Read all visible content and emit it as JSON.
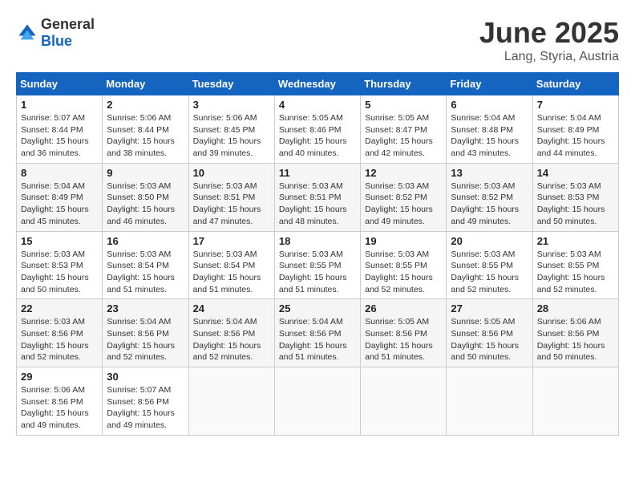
{
  "header": {
    "logo_general": "General",
    "logo_blue": "Blue",
    "title": "June 2025",
    "subtitle": "Lang, Styria, Austria"
  },
  "days_of_week": [
    "Sunday",
    "Monday",
    "Tuesday",
    "Wednesday",
    "Thursday",
    "Friday",
    "Saturday"
  ],
  "weeks": [
    [
      {
        "day": "1",
        "sunrise": "5:07 AM",
        "sunset": "8:44 PM",
        "daylight": "15 hours and 36 minutes."
      },
      {
        "day": "2",
        "sunrise": "5:06 AM",
        "sunset": "8:44 PM",
        "daylight": "15 hours and 38 minutes."
      },
      {
        "day": "3",
        "sunrise": "5:06 AM",
        "sunset": "8:45 PM",
        "daylight": "15 hours and 39 minutes."
      },
      {
        "day": "4",
        "sunrise": "5:05 AM",
        "sunset": "8:46 PM",
        "daylight": "15 hours and 40 minutes."
      },
      {
        "day": "5",
        "sunrise": "5:05 AM",
        "sunset": "8:47 PM",
        "daylight": "15 hours and 42 minutes."
      },
      {
        "day": "6",
        "sunrise": "5:04 AM",
        "sunset": "8:48 PM",
        "daylight": "15 hours and 43 minutes."
      },
      {
        "day": "7",
        "sunrise": "5:04 AM",
        "sunset": "8:49 PM",
        "daylight": "15 hours and 44 minutes."
      }
    ],
    [
      {
        "day": "8",
        "sunrise": "5:04 AM",
        "sunset": "8:49 PM",
        "daylight": "15 hours and 45 minutes."
      },
      {
        "day": "9",
        "sunrise": "5:03 AM",
        "sunset": "8:50 PM",
        "daylight": "15 hours and 46 minutes."
      },
      {
        "day": "10",
        "sunrise": "5:03 AM",
        "sunset": "8:51 PM",
        "daylight": "15 hours and 47 minutes."
      },
      {
        "day": "11",
        "sunrise": "5:03 AM",
        "sunset": "8:51 PM",
        "daylight": "15 hours and 48 minutes."
      },
      {
        "day": "12",
        "sunrise": "5:03 AM",
        "sunset": "8:52 PM",
        "daylight": "15 hours and 49 minutes."
      },
      {
        "day": "13",
        "sunrise": "5:03 AM",
        "sunset": "8:52 PM",
        "daylight": "15 hours and 49 minutes."
      },
      {
        "day": "14",
        "sunrise": "5:03 AM",
        "sunset": "8:53 PM",
        "daylight": "15 hours and 50 minutes."
      }
    ],
    [
      {
        "day": "15",
        "sunrise": "5:03 AM",
        "sunset": "8:53 PM",
        "daylight": "15 hours and 50 minutes."
      },
      {
        "day": "16",
        "sunrise": "5:03 AM",
        "sunset": "8:54 PM",
        "daylight": "15 hours and 51 minutes."
      },
      {
        "day": "17",
        "sunrise": "5:03 AM",
        "sunset": "8:54 PM",
        "daylight": "15 hours and 51 minutes."
      },
      {
        "day": "18",
        "sunrise": "5:03 AM",
        "sunset": "8:55 PM",
        "daylight": "15 hours and 51 minutes."
      },
      {
        "day": "19",
        "sunrise": "5:03 AM",
        "sunset": "8:55 PM",
        "daylight": "15 hours and 52 minutes."
      },
      {
        "day": "20",
        "sunrise": "5:03 AM",
        "sunset": "8:55 PM",
        "daylight": "15 hours and 52 minutes."
      },
      {
        "day": "21",
        "sunrise": "5:03 AM",
        "sunset": "8:55 PM",
        "daylight": "15 hours and 52 minutes."
      }
    ],
    [
      {
        "day": "22",
        "sunrise": "5:03 AM",
        "sunset": "8:56 PM",
        "daylight": "15 hours and 52 minutes."
      },
      {
        "day": "23",
        "sunrise": "5:04 AM",
        "sunset": "8:56 PM",
        "daylight": "15 hours and 52 minutes."
      },
      {
        "day": "24",
        "sunrise": "5:04 AM",
        "sunset": "8:56 PM",
        "daylight": "15 hours and 52 minutes."
      },
      {
        "day": "25",
        "sunrise": "5:04 AM",
        "sunset": "8:56 PM",
        "daylight": "15 hours and 51 minutes."
      },
      {
        "day": "26",
        "sunrise": "5:05 AM",
        "sunset": "8:56 PM",
        "daylight": "15 hours and 51 minutes."
      },
      {
        "day": "27",
        "sunrise": "5:05 AM",
        "sunset": "8:56 PM",
        "daylight": "15 hours and 50 minutes."
      },
      {
        "day": "28",
        "sunrise": "5:06 AM",
        "sunset": "8:56 PM",
        "daylight": "15 hours and 50 minutes."
      }
    ],
    [
      {
        "day": "29",
        "sunrise": "5:06 AM",
        "sunset": "8:56 PM",
        "daylight": "15 hours and 49 minutes."
      },
      {
        "day": "30",
        "sunrise": "5:07 AM",
        "sunset": "8:56 PM",
        "daylight": "15 hours and 49 minutes."
      },
      null,
      null,
      null,
      null,
      null
    ]
  ]
}
